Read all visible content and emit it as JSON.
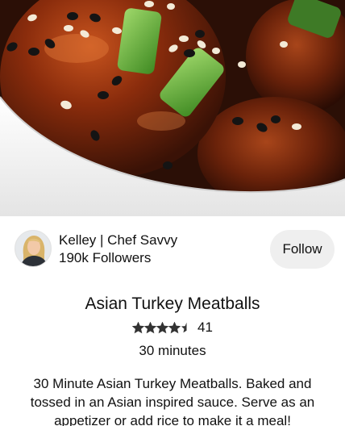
{
  "hero": {
    "image_alt": "Asian turkey meatballs with sesame seeds and green onion in a white bowl"
  },
  "creator": {
    "name": "Kelley | Chef Savvy",
    "followers": "190k Followers",
    "follow_label": "Follow"
  },
  "pin": {
    "title": "Asian Turkey Meatballs",
    "rating_value": 4.5,
    "rating_count": "41",
    "cook_time": "30 minutes",
    "description": "30 Minute Asian Turkey Meatballs. Baked and tossed in an Asian inspired sauce. Serve as an appetizer or add rice to make it a meal!"
  },
  "colors": {
    "star": "#333333",
    "follow_bg": "#efefef",
    "text": "#111111"
  }
}
